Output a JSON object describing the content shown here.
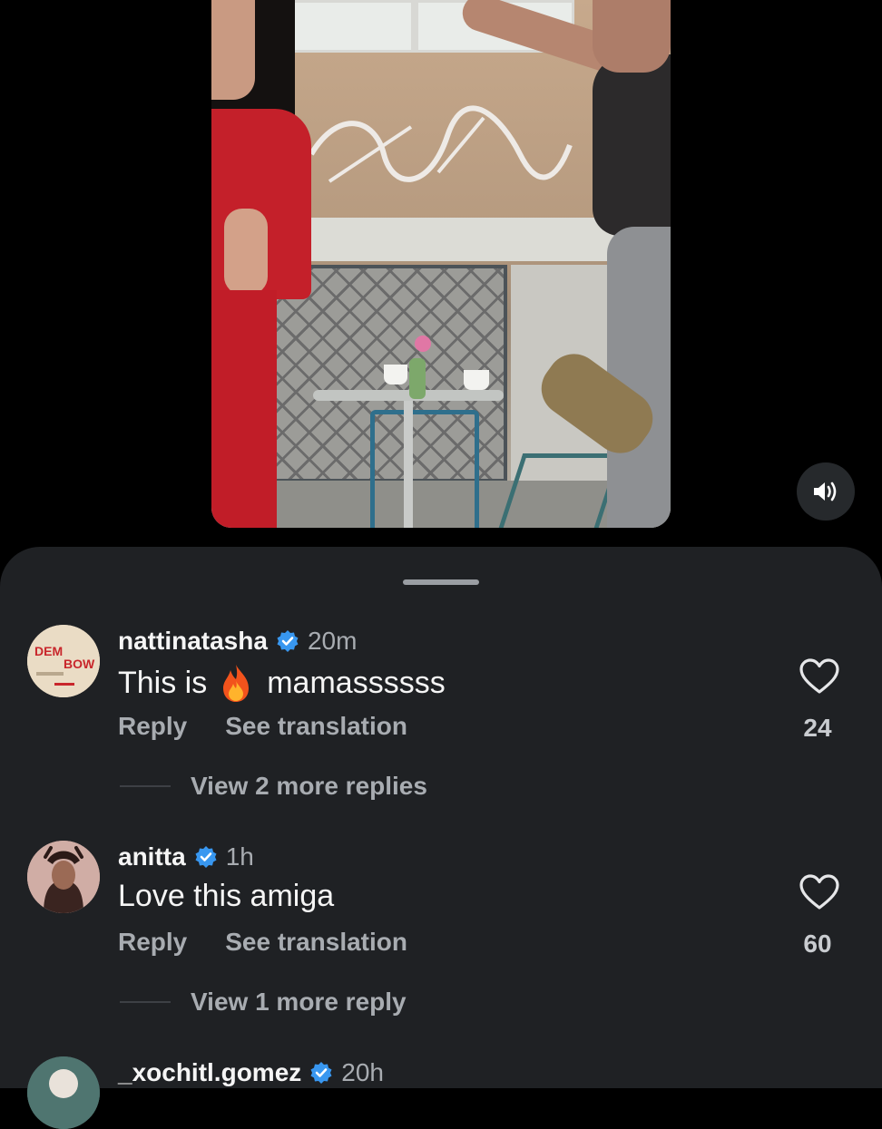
{
  "video": {
    "sound_icon": "speaker-on-icon"
  },
  "comments": [
    {
      "username": "nattinatasha",
      "verified": true,
      "time": "20m",
      "text_before": "This is",
      "emoji": "fire",
      "text_after": "mamassssss",
      "reply_label": "Reply",
      "translate_label": "See translation",
      "likes": "24",
      "view_replies": "View 2 more replies",
      "avatar_text": "DEM BOW"
    },
    {
      "username": "anitta",
      "verified": true,
      "time": "1h",
      "text": "Love this amiga",
      "reply_label": "Reply",
      "translate_label": "See translation",
      "likes": "60",
      "view_replies": "View 1 more reply"
    },
    {
      "username": "_xochitl.gomez",
      "verified": true,
      "time": "20h"
    }
  ],
  "colors": {
    "sheet_bg": "#1f2124",
    "verified_blue": "#3897f0",
    "muted_text": "#a8acb1"
  }
}
